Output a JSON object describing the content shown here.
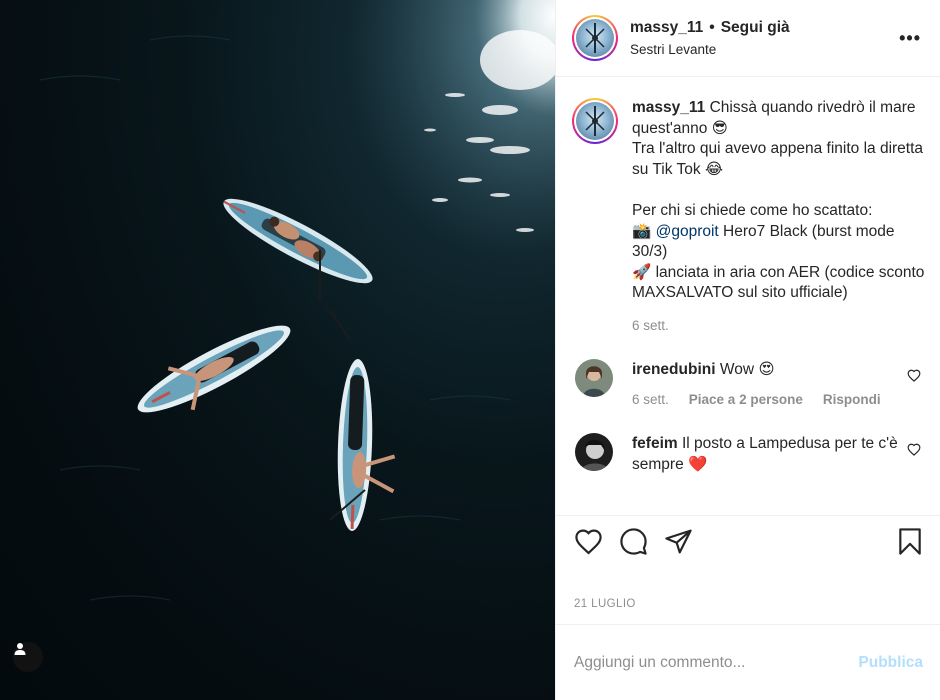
{
  "post": {
    "username": "massy_11",
    "follow_status": "Segui già",
    "location": "Sestri Levante",
    "more_icon": "more-options-icon"
  },
  "caption": {
    "username": "massy_11",
    "line1": "Chissà quando rivedrò il mare quest'anno 😎\nTra l'altro qui avevo appena finito la diretta su Tik Tok 😂\n\nPer chi si chiede come ho scattato:\n📸 ",
    "mention": "@goproit",
    "line2": " Hero7 Black (burst mode 30/3)\n🚀 lanciata in aria con AER (codice sconto MAXSALVATO sul sito ufficiale)",
    "time": "6 sett."
  },
  "comments": [
    {
      "username": "irenedubini",
      "text": "Wow 😍",
      "time": "6 sett.",
      "likes": "Piace a 2 persone",
      "reply": "Rispondi"
    },
    {
      "username": "fefeim",
      "text": "Il posto a Lampedusa per te c'è sempre ❤️"
    }
  ],
  "actions": {
    "icons": [
      "heart-icon",
      "comment-icon",
      "share-icon",
      "bookmark-icon"
    ]
  },
  "date": "21 LUGLIO",
  "add_comment": {
    "placeholder": "Aggiungi un commento...",
    "publish_label": "Pubblica"
  },
  "colors": {
    "link": "#00376b",
    "muted": "#8e8e8e",
    "publish_disabled": "#b2dffc",
    "water": "#08161b"
  }
}
